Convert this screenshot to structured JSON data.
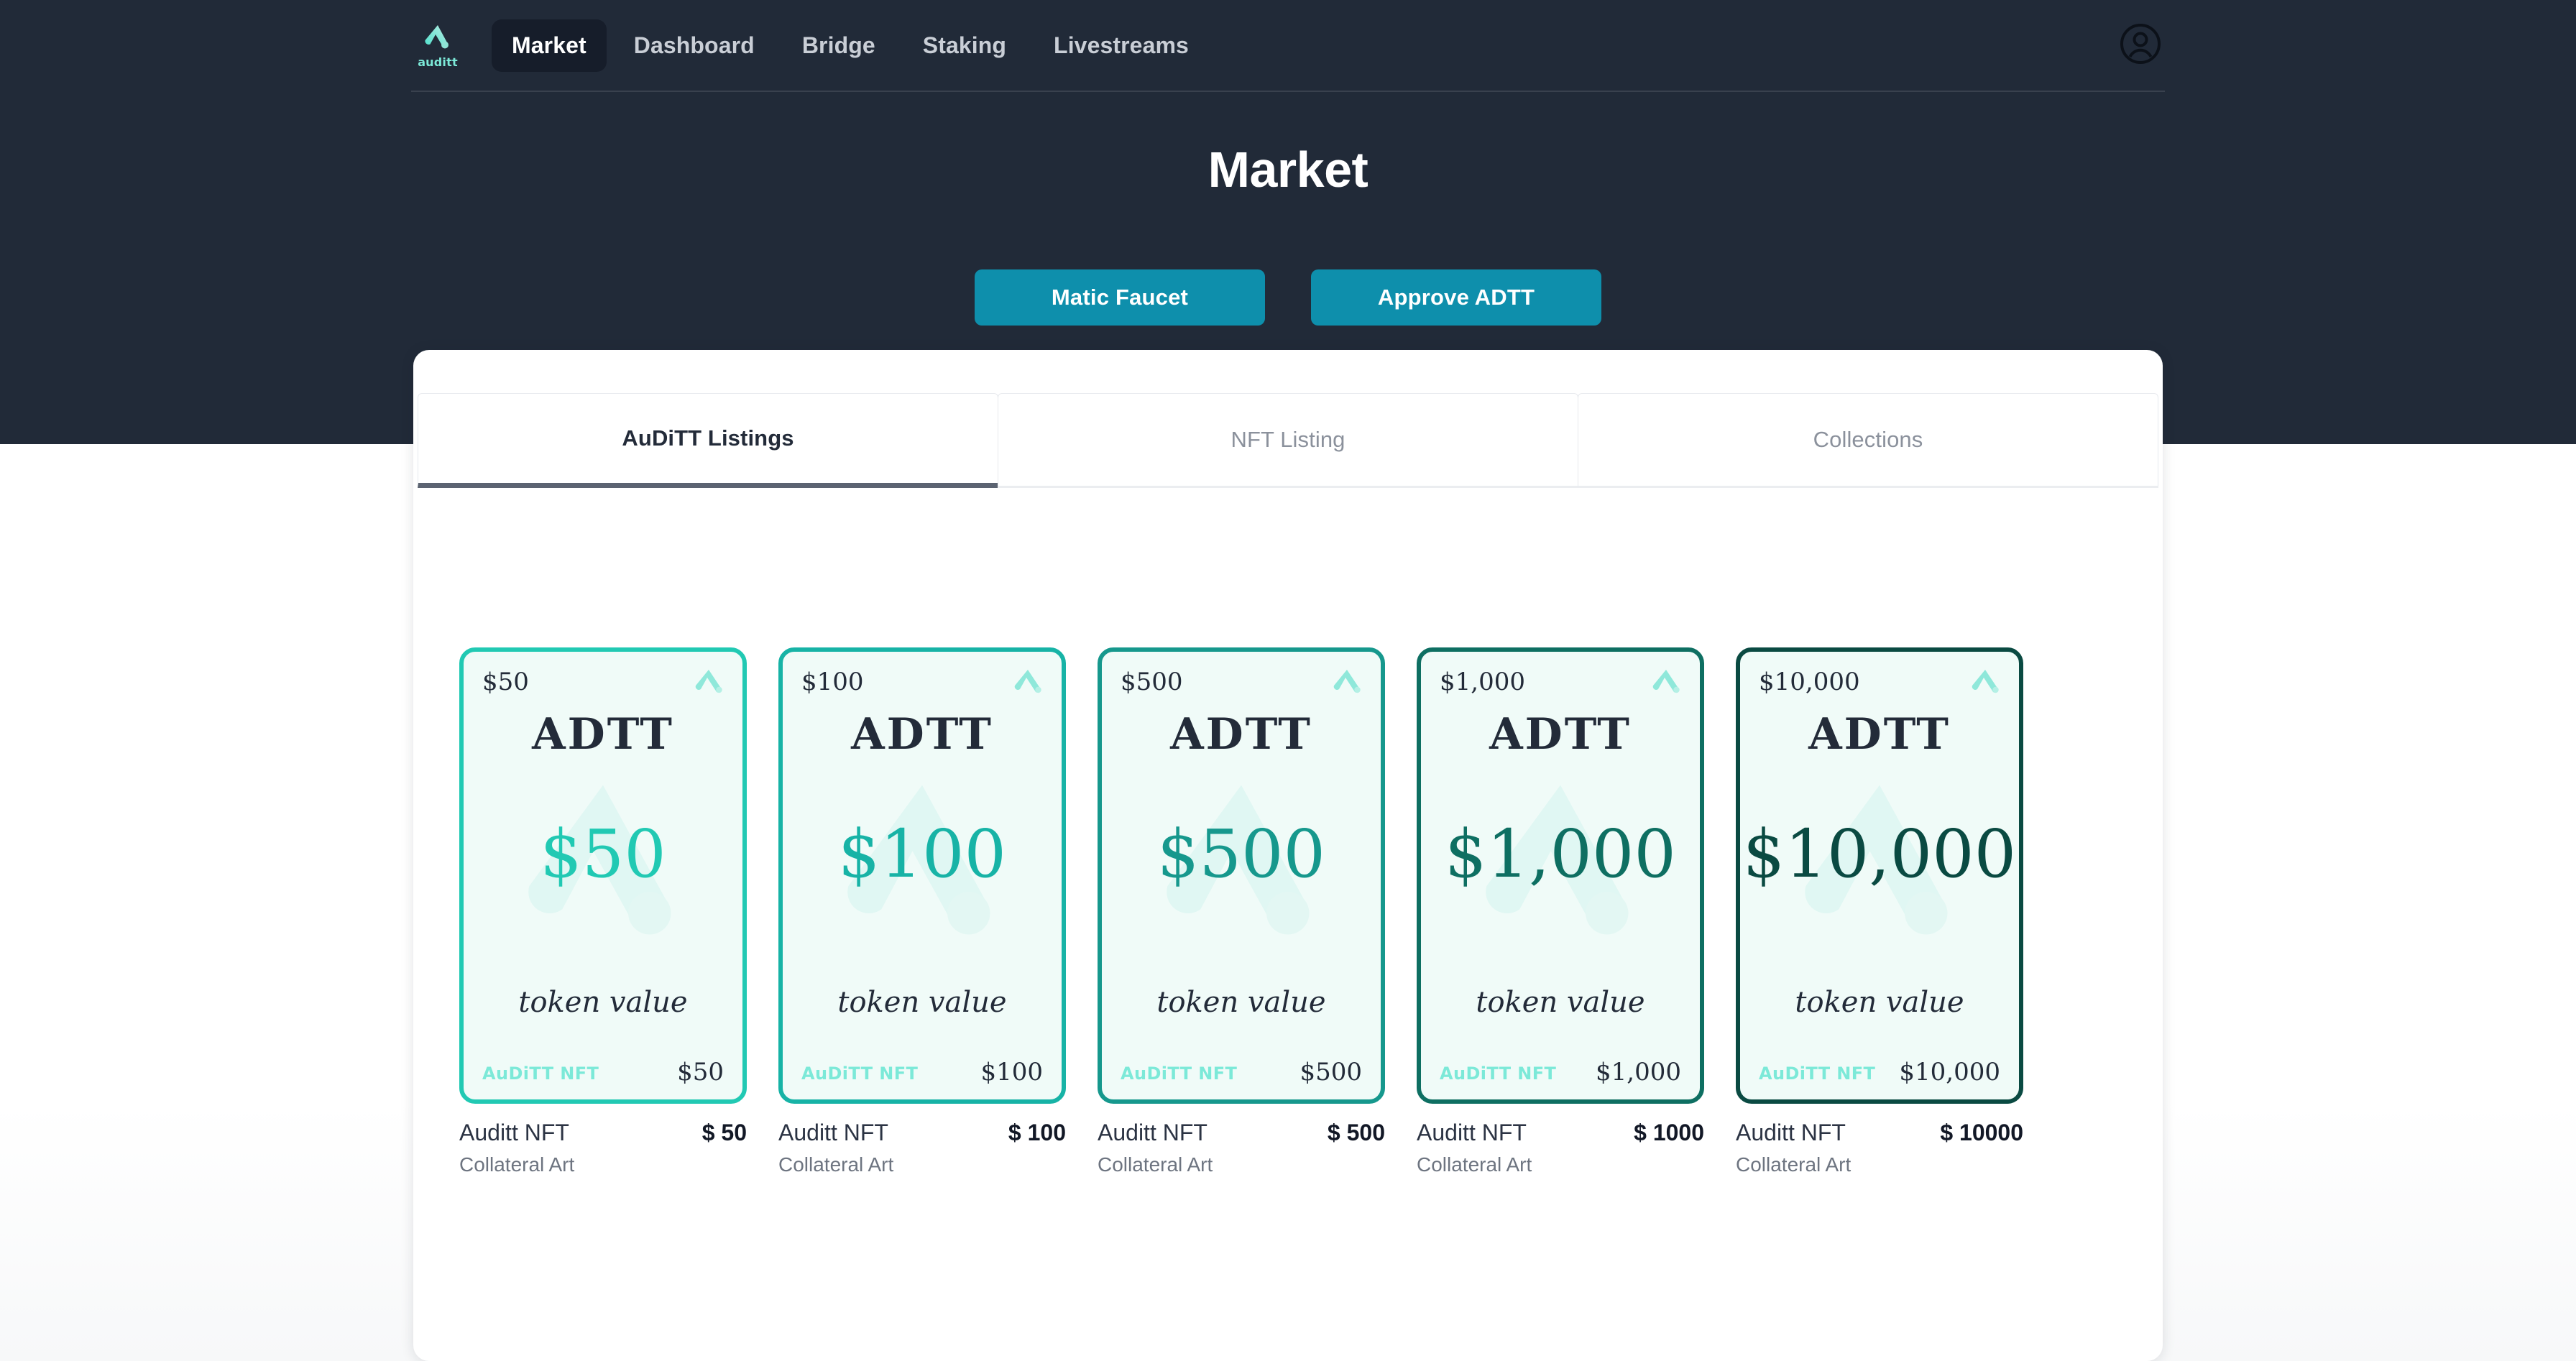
{
  "brand": {
    "word": "auditt",
    "logo_icon": "auditt-logo-icon"
  },
  "nav": {
    "items": [
      {
        "label": "Market",
        "active": true
      },
      {
        "label": "Dashboard",
        "active": false
      },
      {
        "label": "Bridge",
        "active": false
      },
      {
        "label": "Staking",
        "active": false
      },
      {
        "label": "Livestreams",
        "active": false
      }
    ],
    "account_icon": "user-account-icon"
  },
  "hero": {
    "title": "Market",
    "buttons": [
      {
        "label": "Matic Faucet",
        "name": "matic-faucet-button"
      },
      {
        "label": "Approve ADTT",
        "name": "approve-adtt-button"
      }
    ]
  },
  "panel": {
    "tabs": [
      {
        "label": "AuDiTT Listings",
        "active": true
      },
      {
        "label": "NFT Listing",
        "active": false
      },
      {
        "label": "Collections",
        "active": false
      }
    ]
  },
  "listings": [
    {
      "corner_value": "$50",
      "art_title": "ADTT",
      "art_value": "$50",
      "art_sub": "token value",
      "art_brand": "AuDiTT NFT",
      "bottom_value": "$50",
      "name": "Auditt NFT",
      "price": "$ 50",
      "collection": "Collateral Art",
      "accent": "#21c9b3",
      "border": "#21c9b3"
    },
    {
      "corner_value": "$100",
      "art_title": "ADTT",
      "art_value": "$100",
      "art_sub": "token value",
      "art_brand": "AuDiTT NFT",
      "bottom_value": "$100",
      "name": "Auditt NFT",
      "price": "$ 100",
      "collection": "Collateral Art",
      "accent": "#17b3a6",
      "border": "#17b3a6"
    },
    {
      "corner_value": "$500",
      "art_title": "ADTT",
      "art_value": "$500",
      "art_sub": "token value",
      "art_brand": "AuDiTT NFT",
      "bottom_value": "$500",
      "name": "Auditt NFT",
      "price": "$ 500",
      "collection": "Collateral Art",
      "accent": "#16988d",
      "border": "#16988d"
    },
    {
      "corner_value": "$1,000",
      "art_title": "ADTT",
      "art_value": "$1,000",
      "art_sub": "token value",
      "art_brand": "AuDiTT NFT",
      "bottom_value": "$1,000",
      "name": "Auditt NFT",
      "price": "$ 1000",
      "collection": "Collateral Art",
      "accent": "#0e6f62",
      "border": "#0e6f62"
    },
    {
      "corner_value": "$10,000",
      "art_title": "ADTT",
      "art_value": "$10,000",
      "art_sub": "token value",
      "art_brand": "AuDiTT NFT",
      "bottom_value": "$10,000",
      "name": "Auditt NFT",
      "price": "$ 10000",
      "collection": "Collateral Art",
      "accent": "#0a4a42",
      "border": "#0a4a42"
    }
  ],
  "colors": {
    "hero_bg": "#212a38",
    "nav_active_bg": "#161d2a",
    "button": "#0e8fac",
    "brand_mint": "#7ce9d8",
    "card_bg": "#f0fbf8",
    "text_dark": "#232b39"
  }
}
